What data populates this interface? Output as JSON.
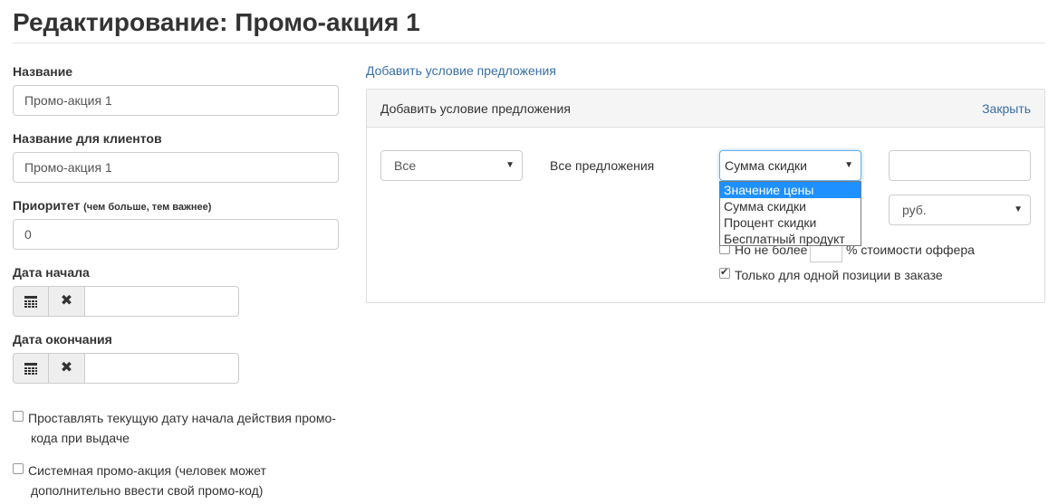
{
  "page": {
    "title": "Редактирование: Промо-акция 1"
  },
  "form": {
    "name": {
      "label": "Название",
      "value": "Промо-акция 1"
    },
    "client_name": {
      "label": "Название для клиентов",
      "value": "Промо-акция 1"
    },
    "priority": {
      "label": "Приоритет",
      "hint": "(чем больше, тем важнее)",
      "value": "0"
    },
    "start_date": {
      "label": "Дата начала",
      "value": ""
    },
    "end_date": {
      "label": "Дата окончания",
      "value": ""
    },
    "auto_date": {
      "line1": "Проставлять текущую дату начала действия промо-",
      "line2": "кода при выдаче",
      "checked": false
    },
    "system_promo": {
      "line1": "Системная промо-акция (человек может",
      "line2": "дополнительно ввести свой промо-код)",
      "checked": false
    }
  },
  "icons": {
    "calendar": "calendar-icon",
    "clear": "close-icon",
    "caret": "caret-down-icon"
  },
  "condition": {
    "add_link": "Добавить условие предложения",
    "panel_title": "Добавить условие предложения",
    "close": "Закрыть",
    "scope_select": "Все",
    "offers_text": "Все предложения",
    "type_select": "Сумма скидки",
    "type_options": [
      "Значение цены",
      "Сумма скидки",
      "Процент скидки",
      "Бесплатный продукт"
    ],
    "highlighted_option": "Значение цены",
    "amount_value": "",
    "currency_select": "руб.",
    "max_prefix": "Но не более",
    "max_suffix": "% стоимости оффера",
    "single_item": "Только для одной позиции в заказе",
    "single_item_checked": true,
    "max_checked": false
  },
  "colors": {
    "link": "#3a6ea5",
    "highlight": "#1e90ff",
    "focus": "#66afe9"
  }
}
